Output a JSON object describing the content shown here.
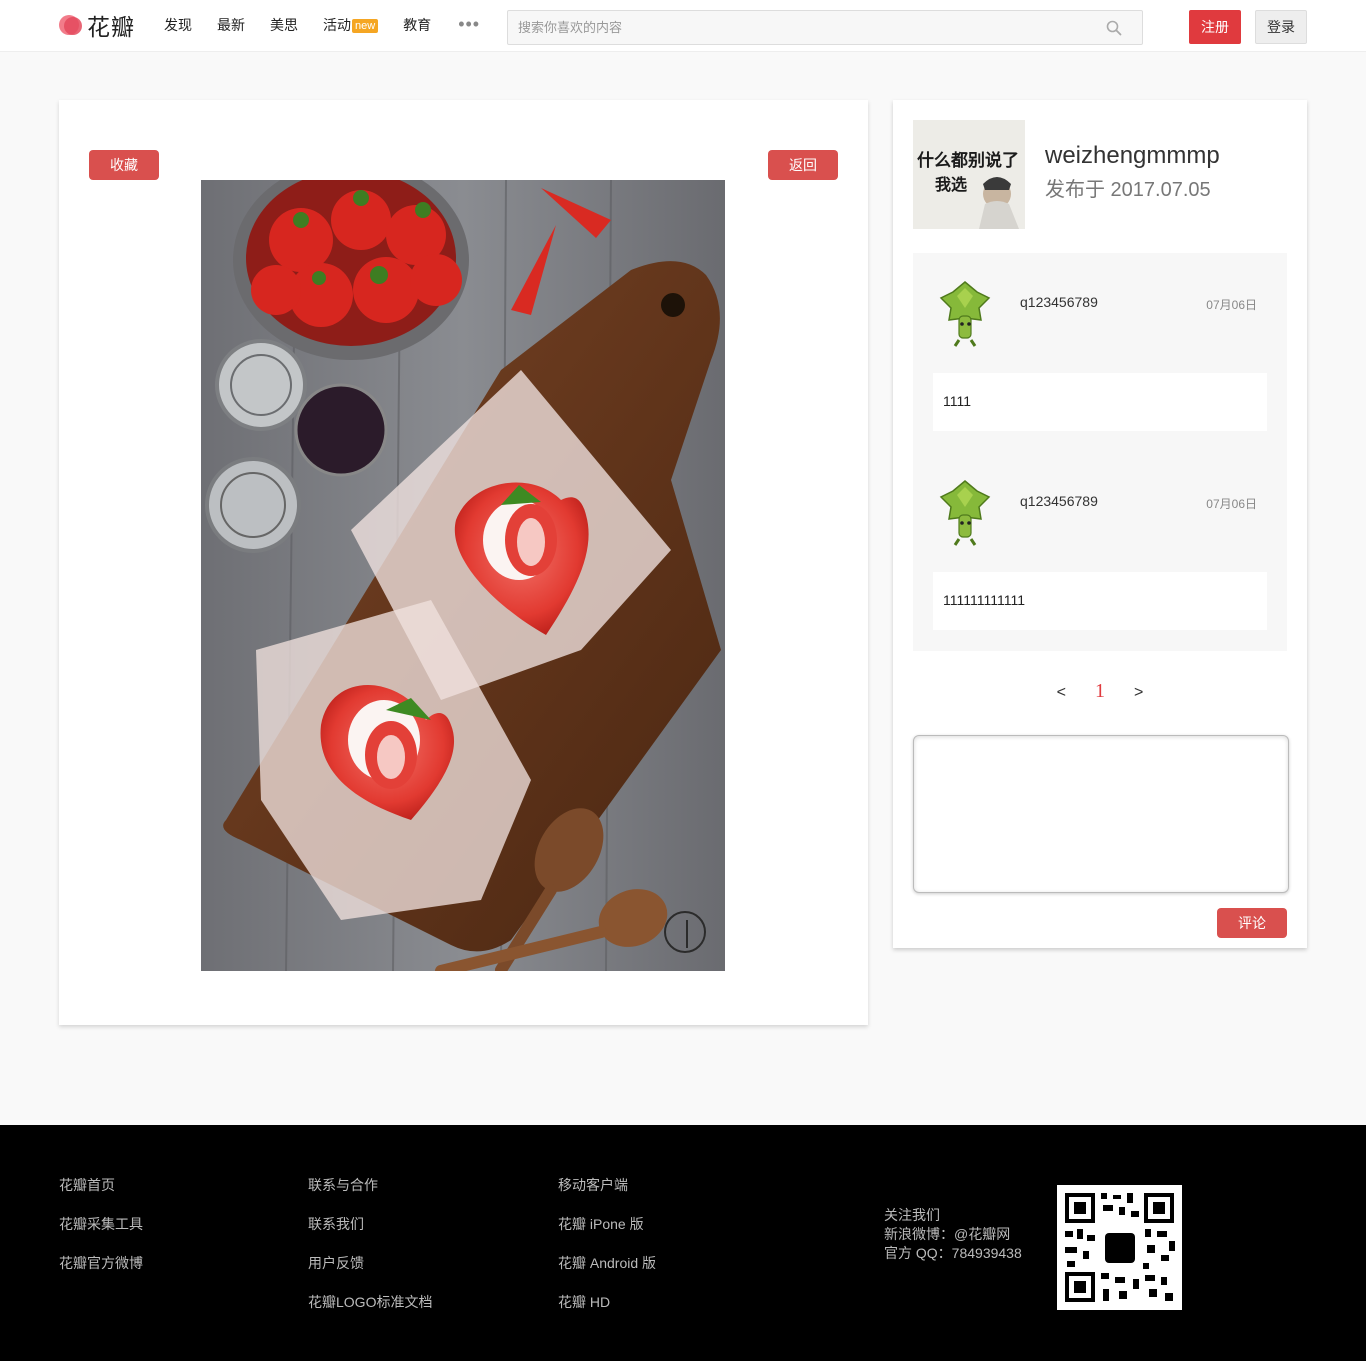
{
  "header": {
    "logo_text": "花瓣",
    "nav": [
      {
        "label": "发现"
      },
      {
        "label": "最新"
      },
      {
        "label": "美思"
      },
      {
        "label": "活动",
        "badge": "new"
      },
      {
        "label": "教育"
      }
    ],
    "more": "•••",
    "search_placeholder": "搜索你喜欢的内容",
    "register_label": "注册",
    "login_label": "登录"
  },
  "pin": {
    "collect_label": "收藏",
    "back_label": "返回"
  },
  "sidebar": {
    "author": "weizhengmmmp",
    "published": "发布于 2017.07.05",
    "avatar_text": "什么都别说了 我选",
    "comments": [
      {
        "user": "q123456789",
        "time": "07月06日",
        "text": "1111"
      },
      {
        "user": "q123456789",
        "time": "07月06日",
        "text": "111111111111"
      }
    ],
    "pager": {
      "prev": "<",
      "current": "1",
      "next": ">"
    },
    "comment_placeholder": "",
    "comment_button": "评论"
  },
  "footer": {
    "col1": [
      "花瓣首页",
      "花瓣采集工具",
      "花瓣官方微博"
    ],
    "col2": [
      "联系与合作",
      "联系我们",
      "用户反馈",
      "花瓣LOGO标准文档"
    ],
    "col3": [
      "移动客户端",
      "花瓣 iPone 版",
      "花瓣 Android 版",
      "花瓣 HD"
    ],
    "follow_title": "关注我们",
    "weibo": "新浪微博：@花瓣网",
    "qq": "官方 QQ：784939438"
  },
  "colors": {
    "accent_red": "#e03a3e",
    "button_red": "#d9504e",
    "footer_bg": "#000000"
  }
}
